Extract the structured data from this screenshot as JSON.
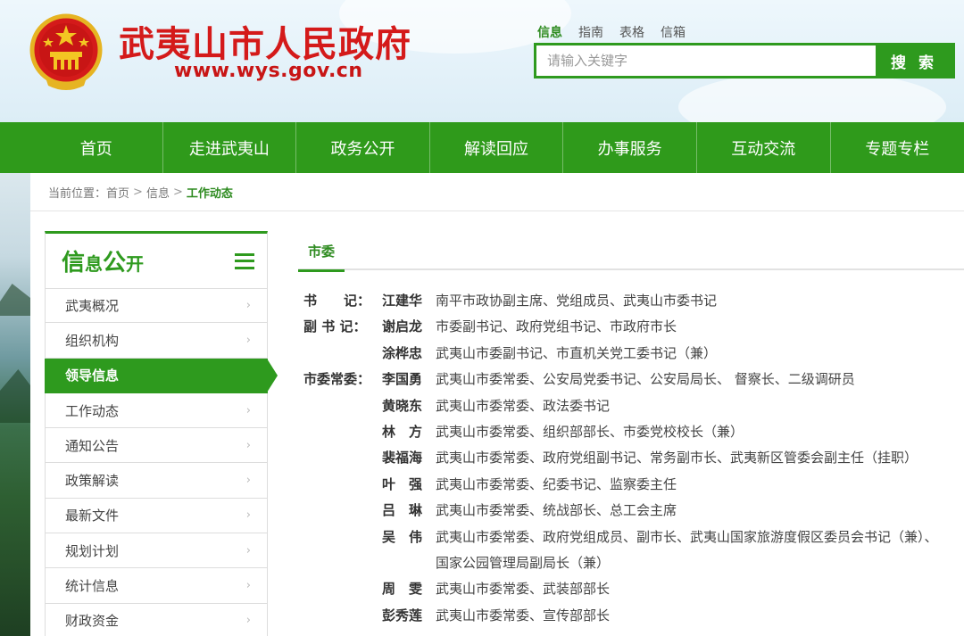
{
  "header": {
    "site_title": "武夷山市人民政府",
    "site_url": "www.wys.gov.cn",
    "search_tabs": [
      "信息",
      "指南",
      "表格",
      "信箱"
    ],
    "search_placeholder": "请输入关键字",
    "search_button": "搜 索"
  },
  "nav": [
    "首页",
    "走进武夷山",
    "政务公开",
    "解读回应",
    "办事服务",
    "互动交流",
    "专题专栏"
  ],
  "breadcrumb": {
    "prefix": "当前位置：",
    "items": [
      "首页",
      "信息"
    ],
    "current": "工作动态",
    "separator": ">"
  },
  "sidebar": {
    "title_big1": "信",
    "title_small1": "息",
    "title_big2": "公",
    "title_small2": "开",
    "items": [
      "武夷概况",
      "组织机构",
      "领导信息",
      "工作动态",
      "通知公告",
      "政策解读",
      "最新文件",
      "规划计划",
      "统计信息",
      "财政资金"
    ],
    "active_index": 2
  },
  "main": {
    "tab": "市委",
    "leaders": [
      {
        "role": "书　　记：",
        "name": "江建华",
        "duty": "南平市政协副主席、党组成员、武夷山市委书记"
      },
      {
        "role": "副 书 记：",
        "name": "谢启龙",
        "duty": "市委副书记、政府党组书记、市政府市长"
      },
      {
        "role": "",
        "name": "涂桦忠",
        "duty": "武夷山市委副书记、市直机关党工委书记（兼）"
      },
      {
        "role": "市委常委：",
        "name": "李国勇",
        "duty": "武夷山市委常委、公安局党委书记、公安局局长、 督察长、二级调研员"
      },
      {
        "role": "",
        "name": "黄晓东",
        "duty": "武夷山市委常委、政法委书记"
      },
      {
        "role": "",
        "name": "林　方",
        "duty": "武夷山市委常委、组织部部长、市委党校校长（兼）"
      },
      {
        "role": "",
        "name": "裴福海",
        "duty": "武夷山市委常委、政府党组副书记、常务副市长、武夷新区管委会副主任（挂职）"
      },
      {
        "role": "",
        "name": "叶　强",
        "duty": "武夷山市委常委、纪委书记、监察委主任"
      },
      {
        "role": "",
        "name": "吕　琳",
        "duty": "武夷山市委常委、统战部长、总工会主席"
      },
      {
        "role": "",
        "name": "吴　伟",
        "duty": "武夷山市委常委、政府党组成员、副市长、武夷山国家旅游度假区委员会书记（兼）、"
      },
      {
        "role": "",
        "name": "",
        "duty": "国家公园管理局副局长（兼）"
      },
      {
        "role": "",
        "name": "周　雯",
        "duty": "武夷山市委常委、武装部部长"
      },
      {
        "role": "",
        "name": "彭秀莲",
        "duty": "武夷山市委常委、宣传部部长"
      }
    ]
  },
  "colors": {
    "brand_green": "#2e9a1e",
    "title_red": "#d41a1a"
  }
}
